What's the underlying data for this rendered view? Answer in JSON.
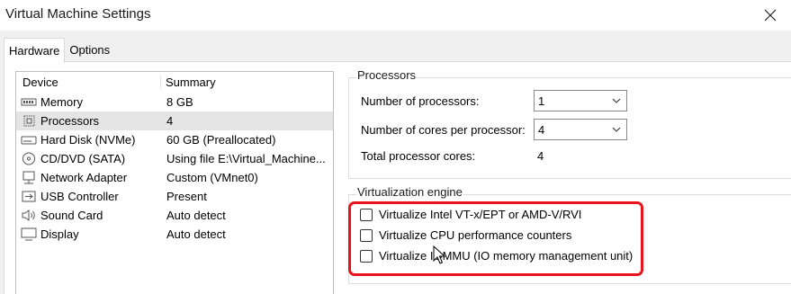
{
  "window": {
    "title": "Virtual Machine Settings",
    "close_icon": "close-icon"
  },
  "tabs": [
    {
      "label": "Hardware",
      "active": true
    },
    {
      "label": "Options",
      "active": false
    }
  ],
  "device_list": {
    "headers": {
      "device": "Device",
      "summary": "Summary"
    },
    "rows": [
      {
        "device": "Memory",
        "summary": "8 GB",
        "icon": "memory-icon"
      },
      {
        "device": "Processors",
        "summary": "4",
        "icon": "processor-icon",
        "selected": true
      },
      {
        "device": "Hard Disk (NVMe)",
        "summary": "60 GB (Preallocated)",
        "icon": "hard-disk-icon"
      },
      {
        "device": "CD/DVD (SATA)",
        "summary": "Using file E:\\Virtual_Machine...",
        "icon": "cd-dvd-icon"
      },
      {
        "device": "Network Adapter",
        "summary": "Custom (VMnet0)",
        "icon": "network-adapter-icon"
      },
      {
        "device": "USB Controller",
        "summary": "Present",
        "icon": "usb-icon"
      },
      {
        "device": "Sound Card",
        "summary": "Auto detect",
        "icon": "speaker-icon"
      },
      {
        "device": "Display",
        "summary": "Auto detect",
        "icon": "display-icon"
      }
    ]
  },
  "processors": {
    "title": "Processors",
    "num_processors_label": "Number of processors:",
    "num_processors_value": "1",
    "cores_label": "Number of cores per processor:",
    "cores_value": "4",
    "total_label": "Total processor cores:",
    "total_value": "4"
  },
  "virtualization": {
    "title": "Virtualization engine",
    "options": [
      {
        "label": "Virtualize Intel VT-x/EPT or AMD-V/RVI",
        "checked": false
      },
      {
        "label": "Virtualize CPU performance counters",
        "checked": false
      },
      {
        "label": "Virtualize IOMMU (IO memory management unit)",
        "checked": false
      }
    ]
  },
  "colors": {
    "highlight": "#e8131b",
    "selected_row": "#e5e5e5",
    "dialog_bg": "#f0f0f0"
  }
}
